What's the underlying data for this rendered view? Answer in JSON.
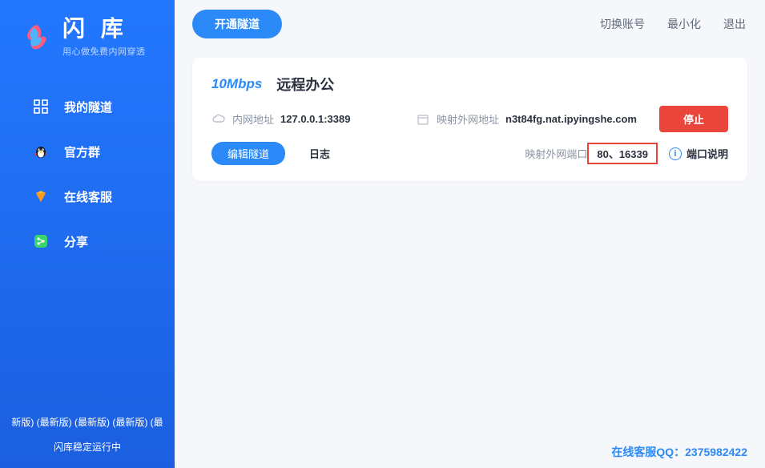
{
  "sidebar": {
    "logo_title": "闪 库",
    "logo_sub": "用心做免费内网穿透",
    "nav": [
      {
        "label": "我的隧道"
      },
      {
        "label": "官方群"
      },
      {
        "label": "在线客服"
      },
      {
        "label": "分享"
      }
    ],
    "version_line": "新版) (最新版) (最新版) (最新版) (最",
    "status_line": "闪库稳定运行中"
  },
  "topbar": {
    "open_tunnel": "开通隧道",
    "links": [
      {
        "label": "切换账号"
      },
      {
        "label": "最小化"
      },
      {
        "label": "退出"
      }
    ]
  },
  "tunnel": {
    "speed": "10Mbps",
    "name": "远程办公",
    "local_label": "内网地址",
    "local_value": "127.0.0.1:3389",
    "ext_addr_label": "映射外网地址",
    "ext_addr_value": "n3t84fg.nat.ipyingshe.com",
    "stop": "停止",
    "edit": "编辑隧道",
    "log": "日志",
    "ext_port_label": "映射外网端口",
    "ext_port_value": "80、16339",
    "port_desc": "端口说明"
  },
  "footer": {
    "qq_label": "在线客服QQ：",
    "qq_value": "2375982422"
  },
  "colors": {
    "primary": "#2b8af7",
    "danger": "#e9453b"
  }
}
